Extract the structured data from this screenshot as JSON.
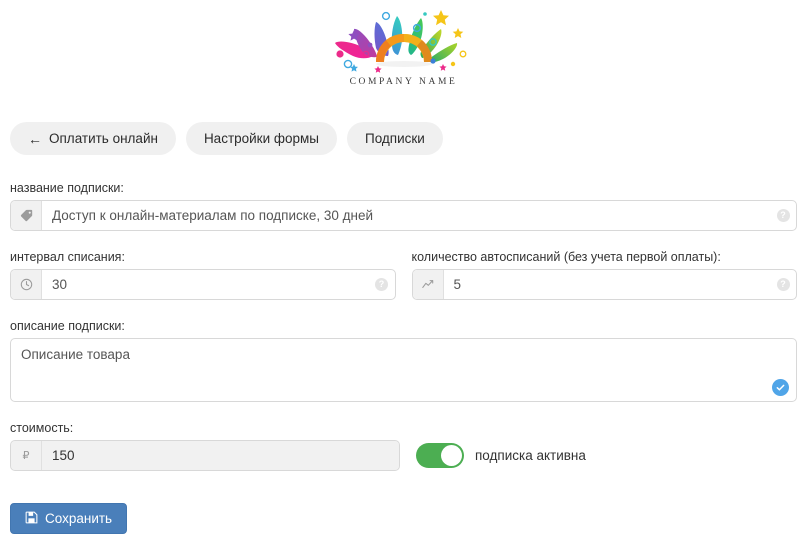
{
  "logo": {
    "company_name": "COMPANY NAME",
    "icon": "colorful-fan-sunburst-logo",
    "petal_colors": [
      "#ec2a8a",
      "#8e4fc0",
      "#5a6fd6",
      "#3fa9e0",
      "#2fc2a8",
      "#4dc14d",
      "#a8cf3a",
      "#f2c41c"
    ],
    "arc_colors": [
      "#f08020",
      "#f29b1d",
      "#f5b91b",
      "#e8a81c",
      "#d98f1c"
    ]
  },
  "tabs": [
    {
      "label": "Оплатить онлайн",
      "icon": "arrow-left-icon",
      "arrow": "←",
      "has_arrow": true
    },
    {
      "label": "Настройки формы",
      "has_arrow": false
    },
    {
      "label": "Подписки",
      "has_arrow": false
    }
  ],
  "form": {
    "subscription_name": {
      "label": "название подписки:",
      "value": "Доступ к онлайн-материалам по подписке, 30 дней",
      "placeholder": "название подписки",
      "prefix_icon": "tag-icon",
      "help_icon": "question-mark-icon"
    },
    "billing_interval": {
      "label": "интервал списания:",
      "value": "30",
      "placeholder": "интервал списания",
      "prefix_icon": "clock-icon",
      "help_icon": "question-mark-icon"
    },
    "autocharge_count": {
      "label": "количество автосписаний (без учета первой оплаты):",
      "value": "5",
      "placeholder": "количество автосписаний",
      "prefix_icon": "chart-line-icon",
      "help_icon": "question-mark-icon"
    },
    "description": {
      "label": "описание подписки:",
      "value": "Описание товара",
      "placeholder": "описание подписки",
      "valid_badge_icon": "check-circle-icon",
      "valid_badge_color": "#50a5e8"
    },
    "cost": {
      "label": "стоимость:",
      "value": "150",
      "placeholder": "стоимость",
      "prefix_icon": "ruble-icon",
      "prefix_symbol": "₽"
    },
    "active_toggle": {
      "label": "подписка активна",
      "state": "on",
      "color": "#4cae52"
    }
  },
  "actions": {
    "save": {
      "label": "Сохранить",
      "icon": "floppy-save-icon",
      "color": "#4a7fba"
    }
  }
}
